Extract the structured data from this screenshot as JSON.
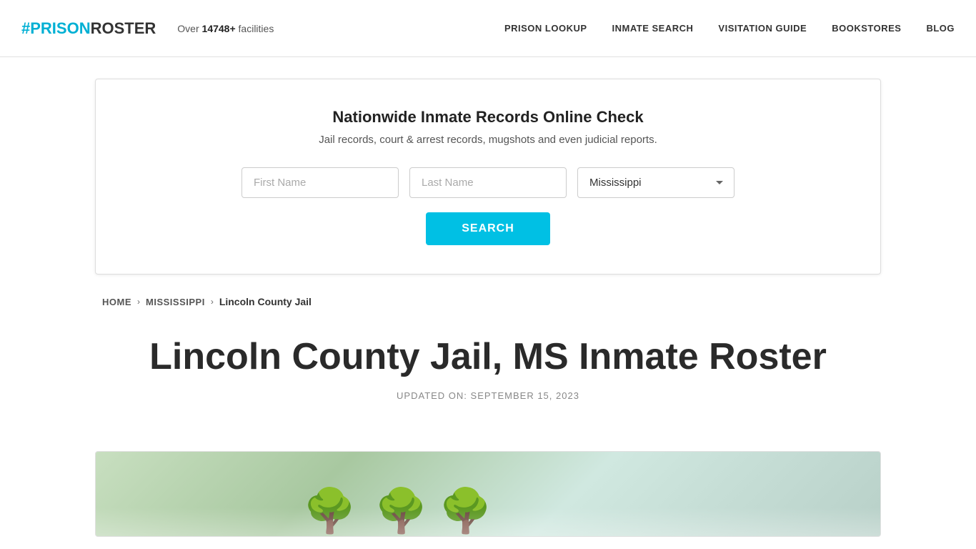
{
  "header": {
    "logo_hash": "#",
    "logo_prison": "PRISON",
    "logo_roster": "ROSTER",
    "facilities_prefix": "Over ",
    "facilities_count": "14748+",
    "facilities_suffix": " facilities",
    "nav": {
      "prison_lookup": "PRISON LOOKUP",
      "inmate_search": "INMATE SEARCH",
      "visitation_guide": "VISITATION GUIDE",
      "bookstores": "BOOKSTORES",
      "blog": "BLOG"
    }
  },
  "search_banner": {
    "title": "Nationwide Inmate Records Online Check",
    "subtitle": "Jail records, court & arrest records, mugshots and even judicial reports.",
    "first_name_placeholder": "First Name",
    "last_name_placeholder": "Last Name",
    "state_value": "Mississippi",
    "search_button": "SEARCH"
  },
  "breadcrumb": {
    "home": "Home",
    "state": "Mississippi",
    "current": "Lincoln County Jail"
  },
  "main": {
    "page_title": "Lincoln County Jail, MS Inmate Roster",
    "updated_label": "UPDATED ON: SEPTEMBER 15, 2023"
  }
}
